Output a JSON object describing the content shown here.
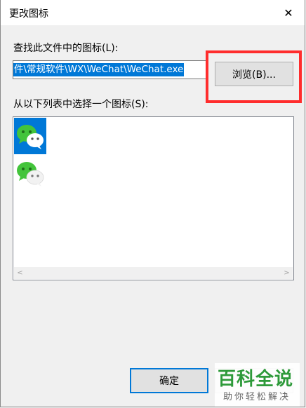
{
  "dialog": {
    "title": "更改图标",
    "close_glyph": "✕"
  },
  "file_section": {
    "label": "查找此文件中的图标(L):",
    "path_value": "件\\常规软件\\WX\\WeChat\\WeChat.exe",
    "browse_label": "浏览(B)..."
  },
  "icons_section": {
    "label": "从以下列表中选择一个图标(S):",
    "items": [
      {
        "icon": "wechat-icon",
        "selected": true
      },
      {
        "icon": "wechat-icon",
        "selected": false
      }
    ],
    "scroll_left": "<",
    "scroll_right": ">"
  },
  "footer": {
    "ok_label": "确定"
  },
  "watermark": {
    "line1": "百科全说",
    "line2": "助你轻松解决"
  },
  "colors": {
    "selection": "#0078d7",
    "highlight_box": "#ff2d2d",
    "wechat_green": "#43c43b",
    "watermark_green": "#2e9a3a"
  }
}
